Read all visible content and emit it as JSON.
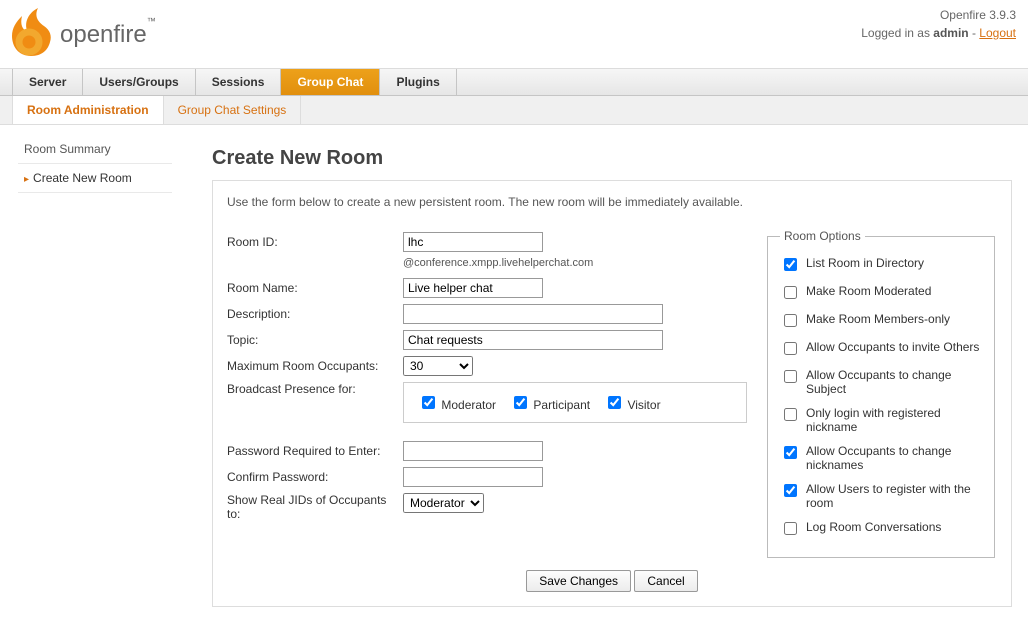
{
  "meta": {
    "version": "Openfire 3.9.3",
    "logged_in_prefix": "Logged in as ",
    "user": "admin",
    "logout": "Logout"
  },
  "logo_text": "openfire",
  "main_tabs": [
    "Server",
    "Users/Groups",
    "Sessions",
    "Group Chat",
    "Plugins"
  ],
  "active_main_tab": 3,
  "sub_tabs": [
    "Room Administration",
    "Group Chat Settings"
  ],
  "sidebar": [
    "Room Summary",
    "Create New Room"
  ],
  "page_title": "Create New Room",
  "intro": "Use the form below to create a new persistent room. The new room will be immediately available.",
  "labels": {
    "room_id": "Room ID:",
    "room_name": "Room Name:",
    "description": "Description:",
    "topic": "Topic:",
    "max_occ": "Maximum Room Occupants:",
    "broadcast": "Broadcast Presence for:",
    "password": "Password Required to Enter:",
    "confirm": "Confirm Password:",
    "show_jids": "Show Real JIDs of Occupants to:"
  },
  "values": {
    "room_id": "lhc",
    "room_id_suffix": "@conference.xmpp.livehelperchat.com",
    "room_name": "Live helper chat",
    "description": "",
    "topic": "Chat requests",
    "max_occ": "30",
    "password": "",
    "confirm": "",
    "show_jids": "Moderator"
  },
  "broadcast": {
    "moderator": "Moderator",
    "participant": "Participant",
    "visitor": "Visitor"
  },
  "options_legend": "Room Options",
  "options": [
    {
      "label": "List Room in Directory",
      "checked": true
    },
    {
      "label": "Make Room Moderated",
      "checked": false
    },
    {
      "label": "Make Room Members-only",
      "checked": false
    },
    {
      "label": "Allow Occupants to invite Others",
      "checked": false
    },
    {
      "label": "Allow Occupants to change Subject",
      "checked": false
    },
    {
      "label": "Only login with registered nickname",
      "checked": false
    },
    {
      "label": "Allow Occupants to change nicknames",
      "checked": true
    },
    {
      "label": "Allow Users to register with the room",
      "checked": true
    },
    {
      "label": "Log Room Conversations",
      "checked": false
    }
  ],
  "buttons": {
    "save": "Save Changes",
    "cancel": "Cancel"
  }
}
